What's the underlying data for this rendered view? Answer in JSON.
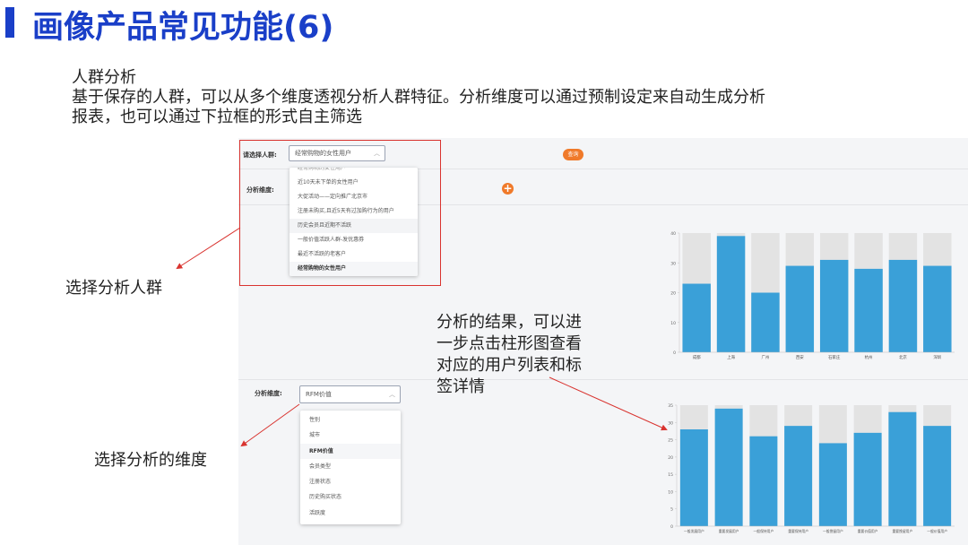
{
  "slide": {
    "title": "画像产品常见功能(6)",
    "intro": [
      "人群分析",
      "基于保存的人群，可以从多个维度透视分析人群特征。分析维度可以通过预制设定来自动生成分析",
      "报表，也可以通过下拉框的形式自主筛选"
    ],
    "callouts": {
      "select_crowd": "选择分析人群",
      "select_dimension": "选择分析的维度",
      "result_lines": [
        "分析的结果，可以进",
        "一步点击柱形图查看",
        "对应的用户列表和标",
        "签详情"
      ]
    }
  },
  "app": {
    "crowd_label": "请选择人群:",
    "crowd_selected": "经常购物的女性用户",
    "query_button": "查询",
    "dimension_label_top": "分析维度:",
    "add_icon": "plus-circle-icon",
    "crowd_options": [
      "经常购物的女性用户",
      "近10天未下单的女性用户",
      "大促活动——定向推广北京市",
      "注册未购买,且近5天有过加购行为的用户",
      "历史会员且近期不活跃",
      "一般价值活跃人群-发优惠券",
      "最近不活跃的老客户",
      "经常购物的女性用户"
    ],
    "dimension_label": "分析维度:",
    "dimension_selected": "RFM价值",
    "dimension_options": [
      "性别",
      "城市",
      "RFM价值",
      "会员类型",
      "注册状态",
      "历史购买状态",
      "活跃度"
    ],
    "colors": {
      "accent": "#f07a2a",
      "bar": "#3aa0d8",
      "bar_bg": "#e3e3e3",
      "title": "#1a3fc8",
      "annotation": "#d9332f"
    }
  },
  "chart_data": [
    {
      "type": "bar",
      "categories": [
        "成都",
        "上海",
        "广州",
        "西安",
        "石家庄",
        "杭州",
        "北京",
        "深圳"
      ],
      "values": [
        23,
        39,
        20,
        29,
        31,
        28,
        31,
        29
      ],
      "ylim": [
        0,
        40
      ],
      "yticks": [
        "0",
        "10",
        "20",
        "30",
        "40"
      ],
      "background_bars": true,
      "grid": false
    },
    {
      "type": "bar",
      "categories": [
        "一般发展用户",
        "重要发展用户",
        "一般保持用户",
        "重要保持用户",
        "一般挽留用户",
        "重要价值用户",
        "重要挽留用户",
        "一般价值用户"
      ],
      "values": [
        28,
        34,
        26,
        29,
        24,
        27,
        33,
        29
      ],
      "ylim": [
        0,
        35
      ],
      "yticks": [
        "0",
        "5",
        "10",
        "15",
        "20",
        "25",
        "30",
        "35"
      ],
      "background_bars": true,
      "grid": false
    }
  ]
}
